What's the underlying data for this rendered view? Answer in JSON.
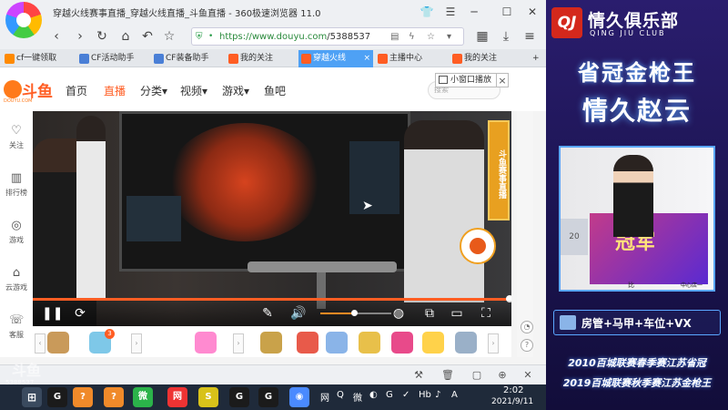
{
  "browser": {
    "window_title": "穿越火线赛事直播_穿越火线直播_斗鱼直播 - 360极速浏览器 11.0",
    "url_host": "https://www.douyu.com",
    "url_path": "/5388537",
    "tabs": [
      {
        "label": "cf一键领取",
        "icon_color": "#ff8a00",
        "active": false
      },
      {
        "label": "CF活动助手",
        "icon_color": "#4a7fd6",
        "active": false
      },
      {
        "label": "CF装备助手",
        "icon_color": "#4a7fd6",
        "active": false
      },
      {
        "label": "我的关注",
        "icon_color": "#ff5d23",
        "active": false
      },
      {
        "label": "穿越火线",
        "icon_color": "#ff5d23",
        "active": true
      },
      {
        "label": "主播中心",
        "icon_color": "#ff5d23",
        "active": false
      },
      {
        "label": "我的关注",
        "icon_color": "#ff5d23",
        "active": false
      }
    ]
  },
  "site": {
    "logo_text": "斗鱼",
    "logo_sub": "DOUYU.COM",
    "nav": [
      {
        "label": "首页",
        "active": false
      },
      {
        "label": "直播",
        "active": true
      },
      {
        "label": "分类▾",
        "active": false
      },
      {
        "label": "视频▾",
        "active": false
      },
      {
        "label": "游戏▾",
        "active": false
      },
      {
        "label": "鱼吧",
        "active": false
      }
    ],
    "search_placeholder": "搜索",
    "miniwindow_tip": "小窗口播放",
    "sidebar": [
      {
        "label": "关注",
        "icon": "heart-icon",
        "glyph": "♡"
      },
      {
        "label": "排行榜",
        "icon": "ranking-icon",
        "glyph": "▥"
      },
      {
        "label": "游戏",
        "icon": "gamepad-icon",
        "glyph": "◎"
      },
      {
        "label": "云游戏",
        "icon": "cloud-game-icon",
        "glyph": "⌂"
      },
      {
        "label": "客服",
        "icon": "service-icon",
        "glyph": "☏"
      }
    ]
  },
  "player": {
    "banner_text": "斗鱼赛事直播",
    "progress_fraction": 1.0,
    "volume_fraction": 0.47
  },
  "gifts": [
    {
      "color": "#c99a5a"
    },
    {
      "color": "#7ec8e8",
      "badge": "3"
    },
    {
      "color": "#ff8ad0"
    },
    {
      "color": "#c9a24a"
    },
    {
      "color": "#e85a4a"
    },
    {
      "color": "#8ab4e8"
    },
    {
      "color": "#e8c04a"
    },
    {
      "color": "#e84a8a"
    },
    {
      "color": "#ffd24a"
    },
    {
      "color": "#9ab0c8"
    }
  ],
  "overlay": {
    "club_logo": "QJ",
    "club_name": "情久俱乐部",
    "club_sub": "QING JIU CLUB",
    "headline1": "省冠金枪王",
    "headline2": "情久赵云",
    "cam_poster": "冠军",
    "cam_side": "20",
    "cam_caption_l": "比",
    "cam_caption_r": "中心店一",
    "perks": "房管+马甲+车位+VX",
    "honors": [
      "2010百城联赛春季赛江苏省冠",
      "2019百城联赛秋季赛江苏金枪王"
    ],
    "accent": "#5aa7ff"
  },
  "watermark": {
    "logo": "斗鱼",
    "room_id": "5388537"
  },
  "taskbar": {
    "time": "2:02",
    "date": "2021/9/11",
    "apps": [
      {
        "label": "G",
        "color": "#1b1b1b"
      },
      {
        "label": "?",
        "color": "#f08a2a"
      },
      {
        "label": "?",
        "color": "#f08a2a"
      },
      {
        "label": "微",
        "color": "#2bb34a"
      },
      {
        "label": "网",
        "color": "#e33"
      },
      {
        "label": "S",
        "color": "#d8c21a"
      },
      {
        "label": "G",
        "color": "#1b1b1b"
      },
      {
        "label": "G",
        "color": "#1b1b1b"
      },
      {
        "label": "◉",
        "color": "#4a8aff"
      }
    ],
    "tray": [
      "网",
      "Q",
      "微",
      "◐",
      "G",
      "✓",
      "Hb",
      "♪",
      "A"
    ]
  }
}
